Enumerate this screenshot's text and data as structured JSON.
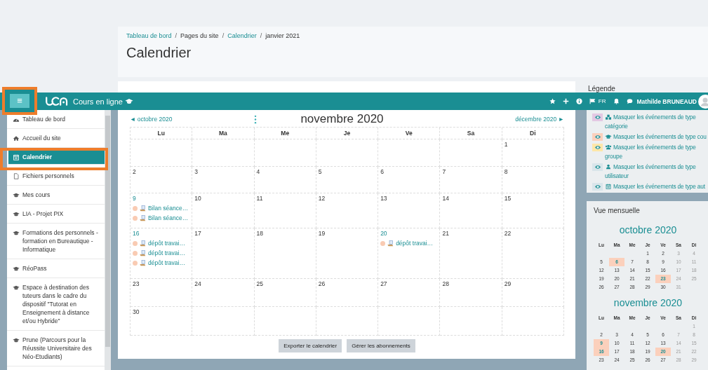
{
  "page_header": {
    "breadcrumb": [
      {
        "label": "Tableau de bord",
        "link": true
      },
      {
        "label": "Pages du site",
        "link": false
      },
      {
        "label": "Calendrier",
        "link": true
      },
      {
        "label": "janvier 2021",
        "link": false
      }
    ],
    "separator": "/",
    "title": "Calendrier"
  },
  "legend_heading": "Légende",
  "navbar": {
    "menu_button": {
      "label": "≡",
      "highlighted": true
    },
    "site_name": "Cours en ligne",
    "language": "FR",
    "user_name": "Mathilde BRUNEAUD"
  },
  "sidebar": {
    "items": [
      {
        "label": "Tableau de bord",
        "kind": "dashboard",
        "selected": false,
        "highlighted": false
      },
      {
        "label": "Accueil du site",
        "kind": "home",
        "selected": false,
        "highlighted": false
      },
      {
        "label": "Calendrier",
        "kind": "calendar",
        "selected": true,
        "highlighted": true
      },
      {
        "label": "Fichiers personnels",
        "kind": "file",
        "selected": false,
        "highlighted": false
      },
      {
        "label": "Mes cours",
        "kind": "course",
        "selected": false,
        "highlighted": false
      },
      {
        "label": "LIA - Projet PIX",
        "kind": "course",
        "selected": false,
        "highlighted": false
      },
      {
        "label": "Formations des personnels - formation en Bureautique - Informatique",
        "kind": "course",
        "selected": false,
        "highlighted": false
      },
      {
        "label": "RéoPass",
        "kind": "course",
        "selected": false,
        "highlighted": false
      },
      {
        "label": "Espace à destination des tuteurs dans le cadre du dispositif \"Tutorat en Enseignement à distance et/ou Hybride\"",
        "kind": "course",
        "selected": false,
        "highlighted": false
      },
      {
        "label": "Prune (Parcours pour la Réussite Universitaire des Néo-Etudiants)",
        "kind": "course",
        "selected": false,
        "highlighted": false
      }
    ]
  },
  "calendar": {
    "prev": "◄ octobre 2020",
    "title": "novembre 2020",
    "next": "décembre 2020 ►",
    "weekdays": [
      "Lu",
      "Ma",
      "Me",
      "Je",
      "Ve",
      "Sa",
      "Di"
    ],
    "weeks": [
      [
        {
          "kind": "blank"
        },
        {
          "kind": "blank"
        },
        {
          "kind": "blank"
        },
        {
          "kind": "blank"
        },
        {
          "kind": "blank"
        },
        {
          "kind": "blank"
        },
        {
          "kind": "day",
          "day": "1"
        }
      ],
      [
        {
          "kind": "day",
          "day": "2"
        },
        {
          "kind": "day",
          "day": "3"
        },
        {
          "kind": "day",
          "day": "4"
        },
        {
          "kind": "day",
          "day": "5"
        },
        {
          "kind": "day",
          "day": "6"
        },
        {
          "kind": "day",
          "day": "7"
        },
        {
          "kind": "day",
          "day": "8"
        }
      ],
      [
        {
          "kind": "day",
          "day": "9",
          "events": [
            "Bilan séance…",
            "Bilan séance…"
          ]
        },
        {
          "kind": "day",
          "day": "10"
        },
        {
          "kind": "day",
          "day": "11"
        },
        {
          "kind": "day",
          "day": "12"
        },
        {
          "kind": "day",
          "day": "13"
        },
        {
          "kind": "day",
          "day": "14"
        },
        {
          "kind": "day",
          "day": "15"
        }
      ],
      [
        {
          "kind": "day",
          "day": "16",
          "events": [
            "dépôt travai…",
            "dépôt travai…",
            "dépôt travai…"
          ]
        },
        {
          "kind": "day",
          "day": "17"
        },
        {
          "kind": "day",
          "day": "18"
        },
        {
          "kind": "day",
          "day": "19"
        },
        {
          "kind": "day",
          "day": "20",
          "events": [
            "dépôt travai…"
          ]
        },
        {
          "kind": "day",
          "day": "21"
        },
        {
          "kind": "day",
          "day": "22"
        }
      ],
      [
        {
          "kind": "day",
          "day": "23"
        },
        {
          "kind": "day",
          "day": "24"
        },
        {
          "kind": "day",
          "day": "25"
        },
        {
          "kind": "day",
          "day": "26"
        },
        {
          "kind": "day",
          "day": "27"
        },
        {
          "kind": "day",
          "day": "28"
        },
        {
          "kind": "day",
          "day": "29"
        }
      ],
      [
        {
          "kind": "day",
          "day": "30"
        },
        {
          "kind": "blank"
        },
        {
          "kind": "blank"
        },
        {
          "kind": "blank"
        },
        {
          "kind": "blank"
        },
        {
          "kind": "blank"
        },
        {
          "kind": "blank"
        }
      ]
    ],
    "buttons": [
      "Exporter le calendrier",
      "Gérer les abonnements"
    ]
  },
  "legend": {
    "items": [
      {
        "label": "Masquer les événements de type catégorie",
        "kind": "category",
        "color": "#e3c8e3"
      },
      {
        "label": "Masquer les événements de type cou",
        "kind": "course",
        "color": "#fbd0bc"
      },
      {
        "label": "Masquer les événements de type groupe",
        "kind": "group",
        "color": "#fde6a8"
      },
      {
        "label": "Masquer les événements de type utilisateur",
        "kind": "user",
        "color": "#d9e5ea"
      },
      {
        "label": "Masquer les événements de type aut",
        "kind": "other",
        "color": "#d9e5ea"
      }
    ]
  },
  "monthly_view": {
    "title": "Vue mensuelle",
    "months": [
      {
        "title": "octobre 2020",
        "weekdays": [
          "Lu",
          "Ma",
          "Me",
          "Je",
          "Ve",
          "Sa",
          "Di"
        ],
        "weeks": [
          [
            {
              "kind": "blank"
            },
            {
              "kind": "blank"
            },
            {
              "kind": "blank"
            },
            {
              "kind": "day",
              "day": "1",
              "highlighted": false
            },
            {
              "kind": "day",
              "day": "2",
              "highlighted": false
            },
            {
              "kind": "day",
              "day": "3",
              "highlighted": false
            },
            {
              "kind": "day",
              "day": "4",
              "highlighted": false
            }
          ],
          [
            {
              "kind": "day",
              "day": "5",
              "highlighted": false
            },
            {
              "kind": "day",
              "day": "6",
              "highlighted": true
            },
            {
              "kind": "day",
              "day": "7",
              "highlighted": false
            },
            {
              "kind": "day",
              "day": "8",
              "highlighted": false
            },
            {
              "kind": "day",
              "day": "9",
              "highlighted": false
            },
            {
              "kind": "day",
              "day": "10",
              "highlighted": false
            },
            {
              "kind": "day",
              "day": "11",
              "highlighted": false
            }
          ],
          [
            {
              "kind": "day",
              "day": "12",
              "highlighted": false
            },
            {
              "kind": "day",
              "day": "13",
              "highlighted": false
            },
            {
              "kind": "day",
              "day": "14",
              "highlighted": false
            },
            {
              "kind": "day",
              "day": "15",
              "highlighted": false
            },
            {
              "kind": "day",
              "day": "16",
              "highlighted": false
            },
            {
              "kind": "day",
              "day": "17",
              "highlighted": false
            },
            {
              "kind": "day",
              "day": "18",
              "highlighted": false
            }
          ],
          [
            {
              "kind": "day",
              "day": "19",
              "highlighted": false
            },
            {
              "kind": "day",
              "day": "20",
              "highlighted": false
            },
            {
              "kind": "day",
              "day": "21",
              "highlighted": false
            },
            {
              "kind": "day",
              "day": "22",
              "highlighted": false
            },
            {
              "kind": "day",
              "day": "23",
              "highlighted": true
            },
            {
              "kind": "day",
              "day": "24",
              "highlighted": false
            },
            {
              "kind": "day",
              "day": "25",
              "highlighted": false
            }
          ],
          [
            {
              "kind": "day",
              "day": "26",
              "highlighted": false
            },
            {
              "kind": "day",
              "day": "27",
              "highlighted": false
            },
            {
              "kind": "day",
              "day": "28",
              "highlighted": false
            },
            {
              "kind": "day",
              "day": "29",
              "highlighted": false
            },
            {
              "kind": "day",
              "day": "30",
              "highlighted": false
            },
            {
              "kind": "day",
              "day": "31",
              "highlighted": false
            }
          ]
        ]
      },
      {
        "title": "novembre 2020",
        "weekdays": [
          "Lu",
          "Ma",
          "Me",
          "Je",
          "Ve",
          "Sa",
          "Di"
        ],
        "weeks": [
          [
            {
              "kind": "blank"
            },
            {
              "kind": "blank"
            },
            {
              "kind": "blank"
            },
            {
              "kind": "blank"
            },
            {
              "kind": "blank"
            },
            {
              "kind": "blank"
            },
            {
              "kind": "day",
              "day": "1",
              "highlighted": false
            }
          ],
          [
            {
              "kind": "day",
              "day": "2",
              "highlighted": false
            },
            {
              "kind": "day",
              "day": "3",
              "highlighted": false
            },
            {
              "kind": "day",
              "day": "4",
              "highlighted": false
            },
            {
              "kind": "day",
              "day": "5",
              "highlighted": false
            },
            {
              "kind": "day",
              "day": "6",
              "highlighted": false
            },
            {
              "kind": "day",
              "day": "7",
              "highlighted": false
            },
            {
              "kind": "day",
              "day": "8",
              "highlighted": false
            }
          ],
          [
            {
              "kind": "day",
              "day": "9",
              "highlighted": true
            },
            {
              "kind": "day",
              "day": "10",
              "highlighted": false
            },
            {
              "kind": "day",
              "day": "11",
              "highlighted": false
            },
            {
              "kind": "day",
              "day": "12",
              "highlighted": false
            },
            {
              "kind": "day",
              "day": "13",
              "highlighted": false
            },
            {
              "kind": "day",
              "day": "14",
              "highlighted": false
            },
            {
              "kind": "day",
              "day": "15",
              "highlighted": false
            }
          ],
          [
            {
              "kind": "day",
              "day": "16",
              "highlighted": true
            },
            {
              "kind": "day",
              "day": "17",
              "highlighted": false
            },
            {
              "kind": "day",
              "day": "18",
              "highlighted": false
            },
            {
              "kind": "day",
              "day": "19",
              "highlighted": false
            },
            {
              "kind": "day",
              "day": "20",
              "highlighted": true
            },
            {
              "kind": "day",
              "day": "21",
              "highlighted": false
            },
            {
              "kind": "day",
              "day": "22",
              "highlighted": false
            }
          ],
          [
            {
              "kind": "day",
              "day": "23",
              "highlighted": false
            },
            {
              "kind": "day",
              "day": "24",
              "highlighted": false
            },
            {
              "kind": "day",
              "day": "25",
              "highlighted": false
            },
            {
              "kind": "day",
              "day": "26",
              "highlighted": false
            },
            {
              "kind": "day",
              "day": "27",
              "highlighted": false
            },
            {
              "kind": "day",
              "day": "28",
              "highlighted": false
            },
            {
              "kind": "day",
              "day": "29",
              "highlighted": false
            }
          ]
        ]
      }
    ]
  }
}
